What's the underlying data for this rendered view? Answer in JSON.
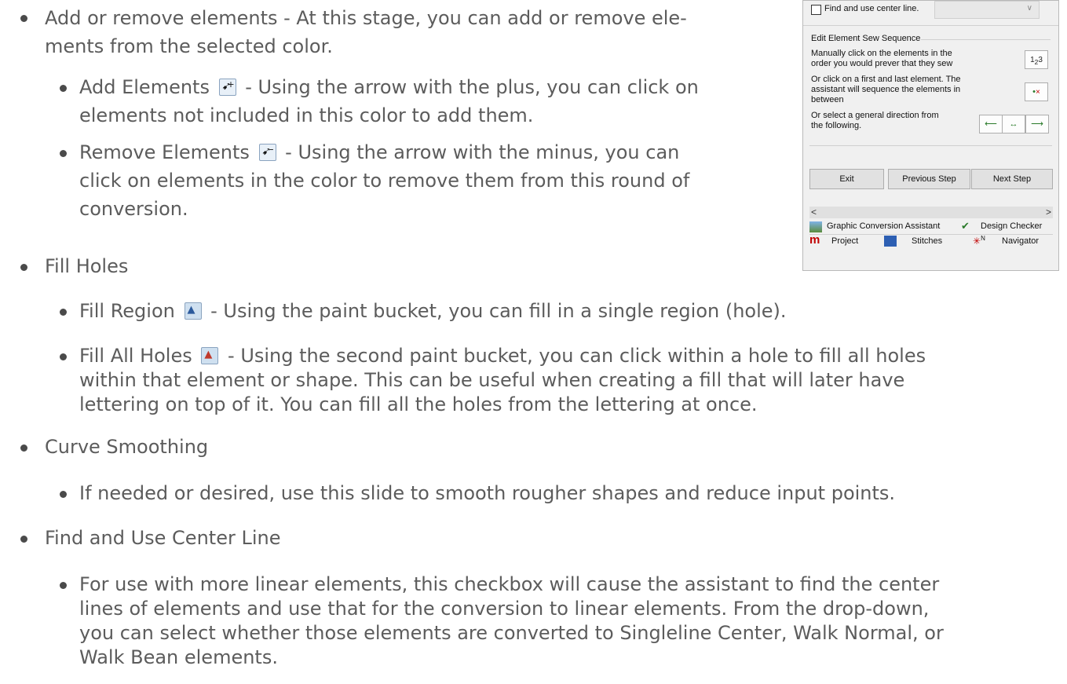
{
  "doc": {
    "b1_title": "Add or remove elements - At this stage, you can add or remove ele-",
    "b1_line2": "ments from the selected color.",
    "b1a_pre": "Add Elements",
    "b1a_post": "- Using the arrow with the plus, you can click on",
    "b1a_line2": "elements not included in this color to add them.",
    "b1b_pre": "Remove Elements",
    "b1b_post": "- Using the arrow with the minus, you can",
    "b1b_line2": "click on elements in the color to remove them from this round of",
    "b1b_line3": "conversion.",
    "b2_title": "Fill Holes",
    "b2a_pre": "Fill Region",
    "b2a_post": "- Using the paint bucket, you can fill in a single region (hole).",
    "b2b_pre": "Fill All Holes",
    "b2b_post": "- Using the second paint bucket, you can click within a hole to fill all holes",
    "b2b_line2": "within that element or shape. This can be useful when creating a fill that will later have",
    "b2b_line3": "lettering on top of it. You can fill all the holes from the lettering at once.",
    "b3_title": "Curve Smoothing",
    "b3a": "If needed or desired, use this slide to smooth rougher shapes and reduce input points.",
    "b4_title": "Find and Use Center Line",
    "b4a_line1": "For use with more linear elements, this checkbox will cause the assistant to find the center",
    "b4a_line2": "lines of elements and use that for the conversion to linear elements. From the drop-down,",
    "b4a_line3": "you can select whether those elements are converted to Singleline Center, Walk Normal, or",
    "b4a_line4": "Walk Bean elements."
  },
  "panel": {
    "center_line_label": "Find and use center line.",
    "center_line_checked": false,
    "group_title": "Edit Element Sew Sequence",
    "manual_line1": "Manually click on the elements in the",
    "manual_line2": "order you would prever that they sew",
    "first_last_line1": "Or click on a first and last element. The",
    "first_last_line2": "assistant will sequence the elements in",
    "first_last_line3": "between",
    "direction_line1": "Or select a general direction from",
    "direction_line2": "the following.",
    "sequence_icon": "123-sequence-icon",
    "exit_label": "Exit",
    "prev_label": "Previous Step",
    "next_label": "Next Step",
    "scroll_left": "<",
    "scroll_right": ">",
    "tab_gca": "Graphic Conversion Assistant",
    "tab_checker": "Design Checker",
    "tab_project": "Project",
    "tab_stitches": "Stitches",
    "tab_navigator": "Navigator",
    "navigator_glyph": "N"
  },
  "colors": {
    "text": "#5c5c5c",
    "panel_bg": "#f0f0f0",
    "accent_green": "#2a7a2a",
    "logo_red": "#c00000"
  }
}
